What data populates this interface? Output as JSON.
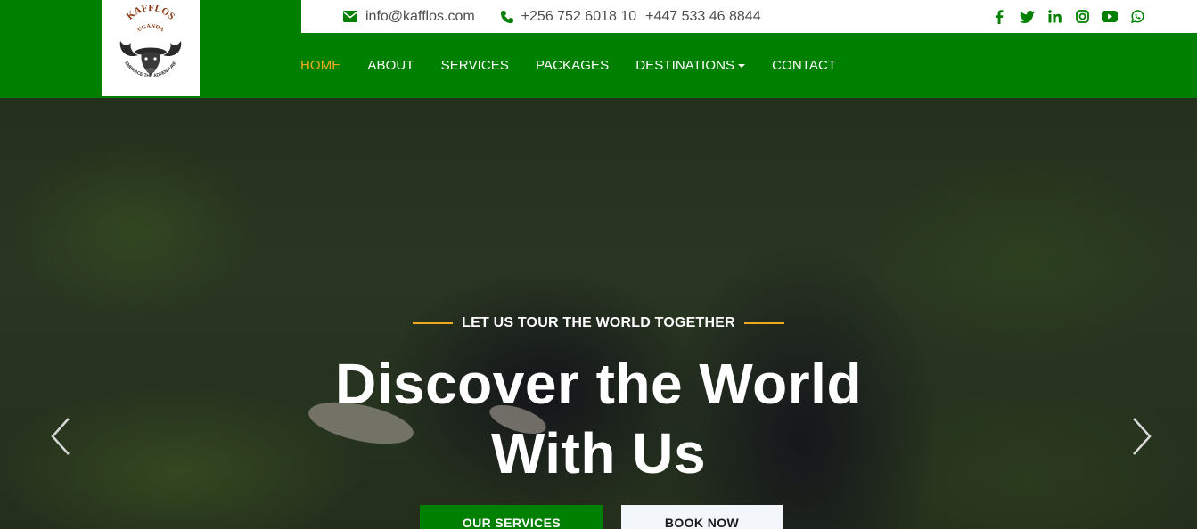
{
  "brand": {
    "logo_text_top": "KAFFLOS",
    "logo_text_sub": "UGANDA",
    "logo_text_bottom": "EMBRACE THE ADVENTURE"
  },
  "topbar": {
    "email": "info@kafflos.com",
    "phone1": "+256 752 6018 10",
    "phone2": "+447 533 46 8844",
    "email_icon": "envelope-icon",
    "phone_icon": "phone-icon",
    "socials": [
      "facebook-icon",
      "twitter-icon",
      "linkedin-icon",
      "instagram-icon",
      "youtube-icon",
      "whatsapp-icon"
    ]
  },
  "nav": {
    "items": [
      {
        "label": "HOME"
      },
      {
        "label": "ABOUT"
      },
      {
        "label": "SERVICES"
      },
      {
        "label": "PACKAGES"
      },
      {
        "label": "DESTINATIONS"
      },
      {
        "label": "CONTACT"
      }
    ]
  },
  "hero": {
    "tagline": "LET US TOUR THE WORLD TOGETHER",
    "headline_line1": "Discover the World",
    "headline_line2": "With Us",
    "btn_primary": "OUR SERVICES",
    "btn_secondary": "BOOK NOW"
  },
  "colors": {
    "brand_green": "#008000",
    "accent_orange": "#f0a81e",
    "white": "#ffffff"
  }
}
